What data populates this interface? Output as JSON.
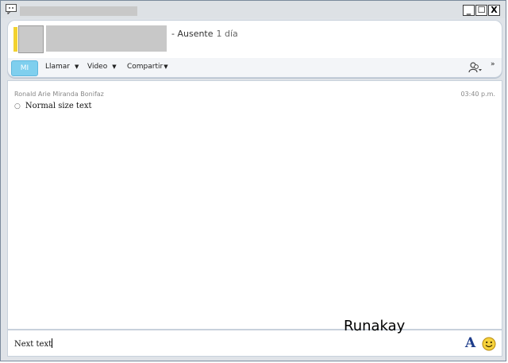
{
  "window": {
    "controls": {
      "minimize": "_",
      "maximize": "☐",
      "close": "X"
    }
  },
  "header": {
    "status": "- Ausente",
    "duration": "1 día"
  },
  "toolbar": {
    "mi": "MI",
    "llamar": "Llamar",
    "video": "Video",
    "compartir": "Compartir",
    "chevron": "»"
  },
  "chat": {
    "sender": "Ronald Arie Miranda Bonifaz",
    "time": "03:40 p.m.",
    "message": "Normal size text"
  },
  "input": {
    "text": "Next text",
    "font_icon": "A"
  },
  "watermark": "Runakay",
  "colors": {
    "accent": "#7fcfee",
    "presence": "#f2d230",
    "font_icon": "#1d3c8a"
  }
}
